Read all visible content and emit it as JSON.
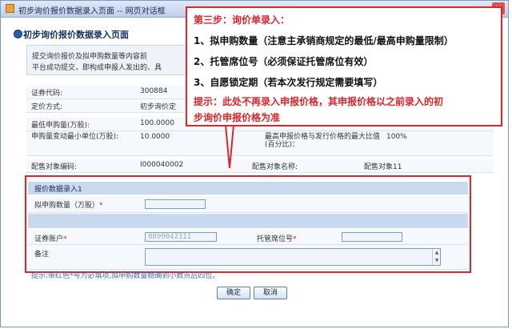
{
  "window": {
    "title": "初步询价报价数据录入页面 -- 网页对话框",
    "close_glyph": "×"
  },
  "page": {
    "heading": "初步询价报价数据录入页面",
    "notice_lines": [
      "提交询价报价及拟申购数量等内容前",
      "平台成功提交，即构成申报人发出的、具"
    ]
  },
  "info_rows": [
    {
      "label": "证券代码:",
      "value": "300884"
    },
    {
      "label": "定价方式:",
      "value": "初步询价定"
    },
    {
      "label": "最低申购量(万股):",
      "value": "100.0000"
    },
    {
      "label": "申购量变动最小单位(万股):",
      "value": "10.0000",
      "right_label": "最高申报价格与发行价格的最大比值(百分比)：",
      "right_value": "100%"
    },
    {
      "label": "配售对象编码:",
      "value": "I000040002",
      "right_label": "配售对象名称:",
      "right_value": "配售对象11"
    }
  ],
  "callout": {
    "step": "第三步：询价单录入：",
    "item1": "1、拟申购数量（注意主承销商规定的最低/最高申购量限制）",
    "item2": "2、托管席位号（必须保证托管席位有效）",
    "item3": "3、自愿锁定期（若本次发行规定需要填写）",
    "tip_line1": "提示：此处不再录入申报价格，其申报价格以之前录入的初",
    "tip_line2": "步询价申报价格为准"
  },
  "form": {
    "section_title": "报价数据录入1",
    "quantity_label": "拟申购数量（万股）",
    "quantity_value": "",
    "account_label": "证券账户",
    "account_value": "0899042311",
    "seat_label": "托管席位号",
    "seat_value": "",
    "remark_label": "备注",
    "remark_value": "",
    "required_mark": "*"
  },
  "hint": "提示:带红色*号为必填项,拟申购数量精确到小数点后四位。",
  "buttons": {
    "confirm": "确定",
    "cancel": "取消"
  },
  "colors": {
    "highlight": "#e0242a",
    "header_blue": "#c9d9ef"
  }
}
